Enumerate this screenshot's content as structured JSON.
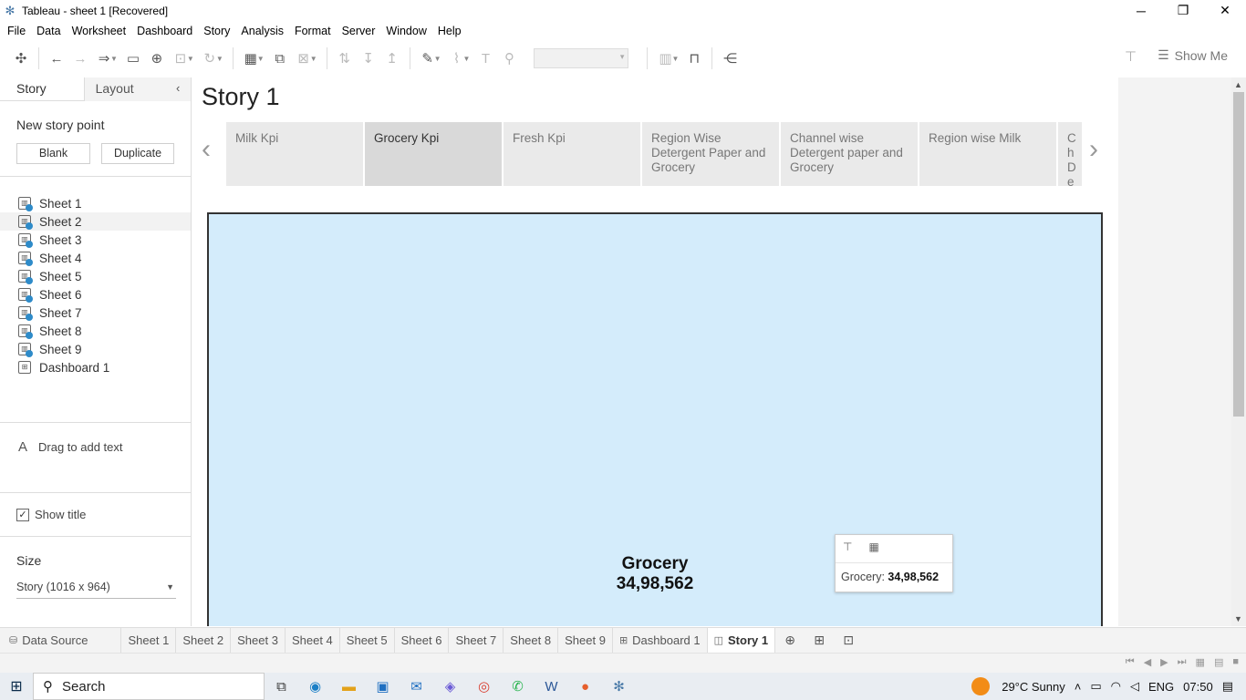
{
  "window": {
    "title": "Tableau - sheet 1 [Recovered]"
  },
  "menu": [
    "File",
    "Data",
    "Worksheet",
    "Dashboard",
    "Story",
    "Analysis",
    "Format",
    "Server",
    "Window",
    "Help"
  ],
  "toolbar": {
    "show_me": "Show Me"
  },
  "sidebar": {
    "tabs": {
      "story": "Story",
      "layout": "Layout"
    },
    "new_story_point": "New story point",
    "blank_button": "Blank",
    "duplicate_button": "Duplicate",
    "sheets": [
      "Sheet 1",
      "Sheet 2",
      "Sheet 3",
      "Sheet 4",
      "Sheet 5",
      "Sheet 6",
      "Sheet 7",
      "Sheet 8",
      "Sheet 9",
      "Dashboard 1"
    ],
    "drag_text": "Drag to add text",
    "show_title": "Show title",
    "size_label": "Size",
    "size_value": "Story (1016 x 964)"
  },
  "story": {
    "title": "Story 1",
    "points": [
      {
        "label": "Milk Kpi"
      },
      {
        "label": "Grocery Kpi",
        "active": true
      },
      {
        "label": "Fresh Kpi"
      },
      {
        "label": "Region Wise Detergent Paper and Grocery"
      },
      {
        "label": "Channel wise Detergent paper and Grocery"
      },
      {
        "label": "Region wise Milk"
      },
      {
        "label": "Ch De Fro"
      }
    ]
  },
  "viz": {
    "measure": "Grocery",
    "value": "34,98,562",
    "background": "#d4ecfb",
    "tooltip": {
      "label": "Grocery:",
      "value": "34,98,562"
    }
  },
  "tabs": [
    {
      "label": "Data Source",
      "icon": "database-icon"
    },
    {
      "label": "Sheet 1"
    },
    {
      "label": "Sheet 2"
    },
    {
      "label": "Sheet 3"
    },
    {
      "label": "Sheet 4"
    },
    {
      "label": "Sheet 5"
    },
    {
      "label": "Sheet 6"
    },
    {
      "label": "Sheet 7"
    },
    {
      "label": "Sheet 8"
    },
    {
      "label": "Sheet 9"
    },
    {
      "label": "Dashboard 1",
      "icon": "dashboard-icon"
    },
    {
      "label": "Story 1",
      "icon": "story-icon",
      "active": true
    }
  ],
  "taskbar": {
    "search": "Search",
    "weather": "29°C  Sunny",
    "language": "ENG",
    "time": "07:50"
  }
}
